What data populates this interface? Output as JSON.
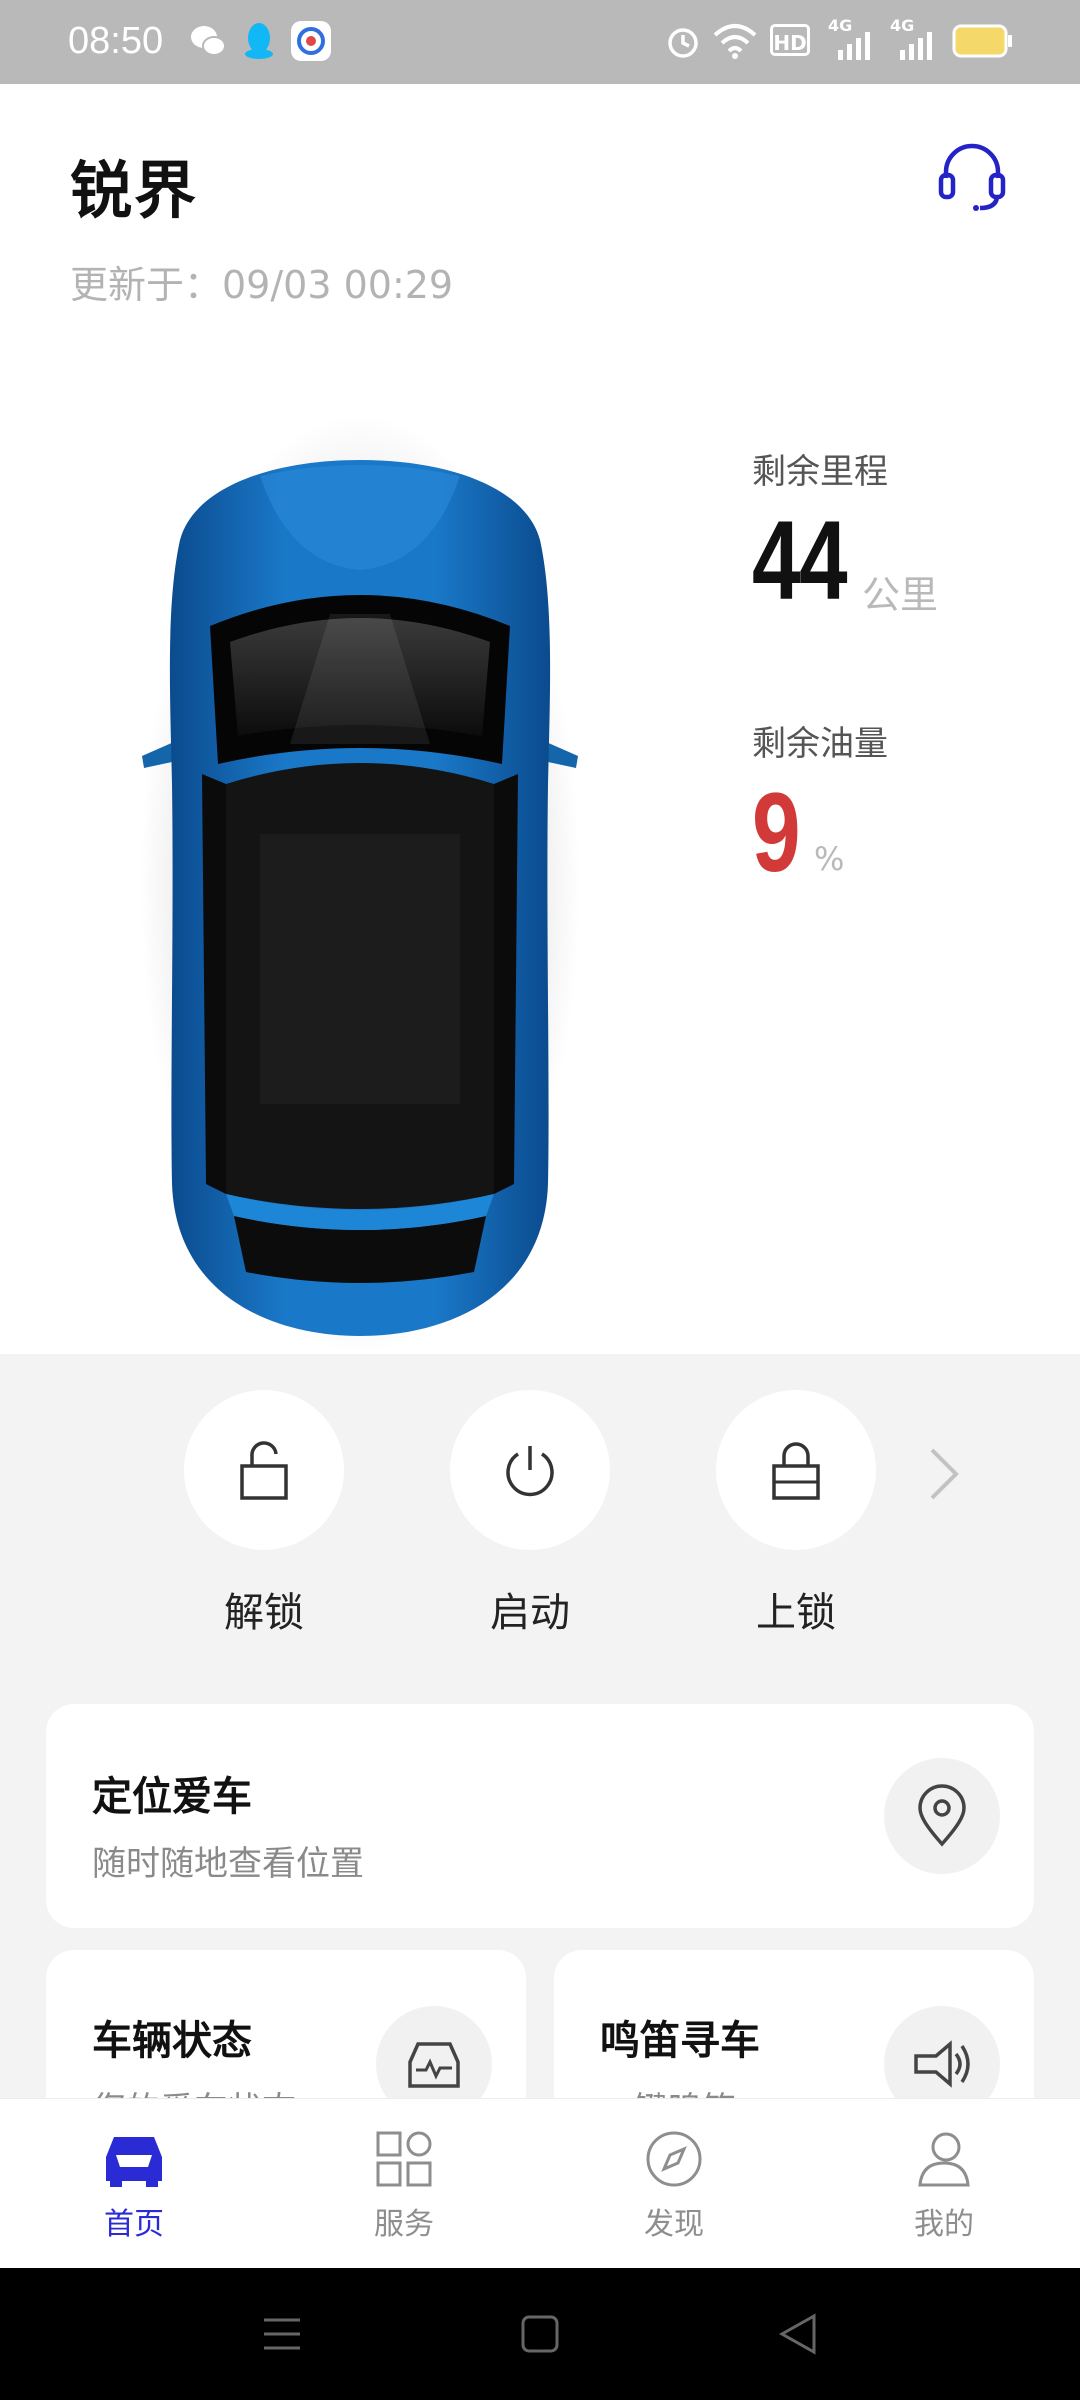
{
  "status_bar": {
    "time": "08:50",
    "left_icons": [
      "wechat-icon",
      "qq-icon",
      "app-icon"
    ],
    "right_icons": [
      "alarm-icon",
      "wifi-icon",
      "hd-icon",
      "signal-4g-icon",
      "signal-4g-icon",
      "battery-icon"
    ],
    "hd_label": "HD",
    "net_label_1": "4G",
    "net_label_2": "4G"
  },
  "header": {
    "title": "锐界",
    "updated": "更新于：09/03 00:29",
    "support_icon": "headset-icon"
  },
  "stats": {
    "range_label": "剩余里程",
    "range_value": "44",
    "range_unit": "公里",
    "fuel_label": "剩余油量",
    "fuel_value": "9",
    "fuel_unit": "%"
  },
  "quick_actions": [
    {
      "label": "解锁",
      "icon": "unlock-icon"
    },
    {
      "label": "启动",
      "icon": "power-icon"
    },
    {
      "label": "上锁",
      "icon": "lock-icon"
    }
  ],
  "cards": {
    "locate": {
      "title": "定位爱车",
      "subtitle": "随时随地查看位置",
      "icon": "location-pin-icon"
    },
    "vehicle_status": {
      "title": "车辆状态",
      "subtitle": "您的爱车状态",
      "icon": "car-status-icon"
    },
    "honk": {
      "title": "鸣笛寻车",
      "subtitle": "一键鸣笛",
      "icon": "horn-icon"
    }
  },
  "tabs": [
    {
      "label": "首页",
      "icon": "car-icon",
      "active": true
    },
    {
      "label": "服务",
      "icon": "grid-icon",
      "active": false
    },
    {
      "label": "发现",
      "icon": "compass-icon",
      "active": false
    },
    {
      "label": "我的",
      "icon": "user-icon",
      "active": false
    }
  ],
  "colors": {
    "accent": "#2b2bd6",
    "fuel_low": "#d23a3a",
    "car_body": "#1769b8"
  }
}
